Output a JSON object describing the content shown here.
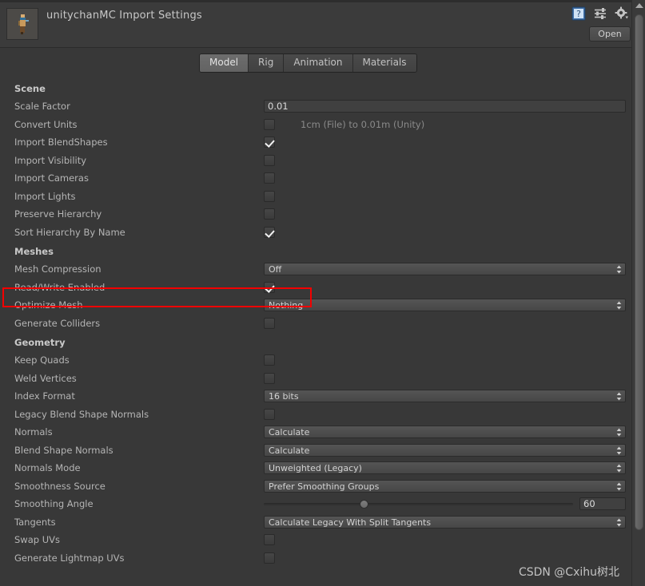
{
  "window": {
    "title": "unitychanMC Import Settings",
    "open_button": "Open",
    "icons": {
      "help": "help-icon",
      "preset": "preset-icon",
      "settings": "gear-icon"
    }
  },
  "tabs": [
    {
      "label": "Model",
      "active": true
    },
    {
      "label": "Rig",
      "active": false
    },
    {
      "label": "Animation",
      "active": false
    },
    {
      "label": "Materials",
      "active": false
    }
  ],
  "sections": {
    "scene": {
      "heading": "Scene",
      "rows": {
        "scale_factor": {
          "label": "Scale Factor",
          "value": "0.01"
        },
        "convert_units": {
          "label": "Convert Units",
          "checked": false,
          "suffix": "1cm (File) to 0.01m (Unity)"
        },
        "import_blendshapes": {
          "label": "Import BlendShapes",
          "checked": true
        },
        "import_visibility": {
          "label": "Import Visibility",
          "checked": false
        },
        "import_cameras": {
          "label": "Import Cameras",
          "checked": false
        },
        "import_lights": {
          "label": "Import Lights",
          "checked": false
        },
        "preserve_hierarchy": {
          "label": "Preserve Hierarchy",
          "checked": false
        },
        "sort_hierarchy_by_name": {
          "label": "Sort Hierarchy By Name",
          "checked": true
        }
      }
    },
    "meshes": {
      "heading": "Meshes",
      "rows": {
        "mesh_compression": {
          "label": "Mesh Compression",
          "value": "Off"
        },
        "read_write_enabled": {
          "label": "Read/Write Enabled",
          "checked": true,
          "highlighted": true
        },
        "optimize_mesh": {
          "label": "Optimize Mesh",
          "value": "Nothing"
        },
        "generate_colliders": {
          "label": "Generate Colliders",
          "checked": false
        }
      }
    },
    "geometry": {
      "heading": "Geometry",
      "rows": {
        "keep_quads": {
          "label": "Keep Quads",
          "checked": false
        },
        "weld_vertices": {
          "label": "Weld Vertices",
          "checked": false
        },
        "index_format": {
          "label": "Index Format",
          "value": "16 bits"
        },
        "legacy_blend_shape_normals": {
          "label": "Legacy Blend Shape Normals",
          "checked": false
        },
        "normals": {
          "label": "Normals",
          "value": "Calculate"
        },
        "blend_shape_normals": {
          "label": "Blend Shape Normals",
          "value": "Calculate"
        },
        "normals_mode": {
          "label": "Normals Mode",
          "value": "Unweighted (Legacy)"
        },
        "smoothness_source": {
          "label": "Smoothness Source",
          "value": "Prefer Smoothing Groups"
        },
        "smoothing_angle": {
          "label": "Smoothing Angle",
          "value": "60"
        },
        "tangents": {
          "label": "Tangents",
          "value": "Calculate Legacy With Split Tangents"
        },
        "swap_uvs": {
          "label": "Swap UVs",
          "checked": false
        },
        "generate_lightmap_uvs": {
          "label": "Generate Lightmap UVs",
          "checked": false
        }
      }
    }
  },
  "annotation": {
    "highlight_color": "#f40000"
  },
  "watermark": "CSDN @Cxihu树北"
}
